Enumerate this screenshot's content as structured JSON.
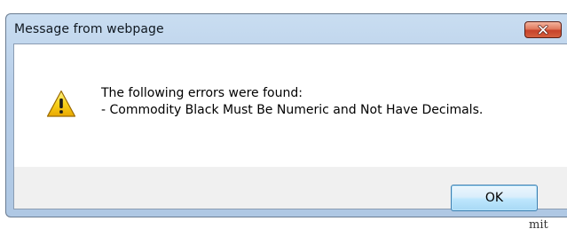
{
  "dialog": {
    "title": "Message from webpage",
    "close_icon": "close-icon",
    "warning_icon": "warning-icon",
    "message_lines": [
      "The following errors were found:",
      "- Commodity Black Must Be Numeric and Not Have Decimals."
    ],
    "ok_label": "OK"
  },
  "background": {
    "partial_text": "mit"
  },
  "colors": {
    "titlebar": "#b6cde8",
    "close_button": "#c7422a",
    "ok_button_border": "#3c7fb1",
    "warning_yellow": "#f5c400"
  }
}
